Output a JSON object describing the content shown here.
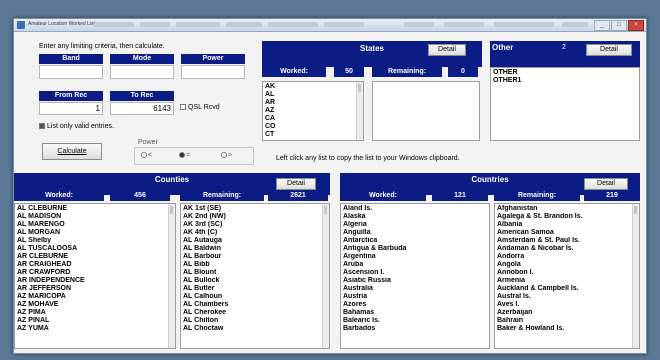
{
  "window": {
    "title": "Amateur Location Worked List"
  },
  "filter": {
    "instruction": "Enter any limiting criteria, then calculate.",
    "band_label": "Band",
    "band_value": "",
    "mode_label": "Mode",
    "mode_value": "",
    "power_label": "Power",
    "power_value": "",
    "from_rec_label": "From Rec",
    "from_rec_value": "1",
    "to_rec_label": "To Rec",
    "to_rec_value": "6143",
    "qsl_label": "QSL Rcvd",
    "valid_only_label": "List only valid entries.",
    "calculate_label": "Calculate",
    "power_group_label": "Power",
    "power_options": [
      "<",
      "=",
      ">"
    ],
    "power_selected": "="
  },
  "hint": "Left click any list to copy the list to your Windows clipboard.",
  "states": {
    "title": "States",
    "detail_label": "Detail",
    "worked_label": "Worked:",
    "worked_count": "50",
    "remaining_label": "Remaining:",
    "remaining_count": "0",
    "worked_items": [
      "AK",
      "AL",
      "AR",
      "AZ",
      "CA",
      "CO",
      "CT"
    ],
    "remaining_items": []
  },
  "other": {
    "title": "Other",
    "count": "2",
    "detail_label": "Detail",
    "items": [
      "OTHER",
      "OTHER1"
    ]
  },
  "counties": {
    "title": "Counties",
    "detail_label": "Detail",
    "worked_label": "Worked:",
    "worked_count": "456",
    "remaining_label": "Remaining:",
    "remaining_count": "2621",
    "worked_items": [
      "AL  CLEBURNE",
      "AL  MADISON",
      "AL  MARENGO",
      "AL  MORGAN",
      "AL  Shelby",
      "AL  TUSCALOOSA",
      "AR  CLEBURNE",
      "AR  CRAIGHEAD",
      "AR  CRAWFORD",
      "AR  INDEPENDENCE",
      "AR  JEFFERSON",
      "AZ  MARICOPA",
      "AZ  MOHAVE",
      "AZ  PIMA",
      "AZ  PINAL",
      "AZ  YUMA"
    ],
    "remaining_items": [
      "AK  1st (SE)",
      "AK  2nd (NW)",
      "AK  3rd (SC)",
      "AK  4th (C)",
      "AL  Autauga",
      "AL  Baldwin",
      "AL  Barbour",
      "AL  Bibb",
      "AL  Blount",
      "AL  Bullock",
      "AL  Butler",
      "AL  Calhoun",
      "AL  Chambers",
      "AL  Cherokee",
      "AL  Chilton",
      "AL  Choctaw"
    ]
  },
  "countries": {
    "title": "Countries",
    "detail_label": "Detail",
    "worked_label": "Worked:",
    "worked_count": "121",
    "remaining_label": "Remaining:",
    "remaining_count": "219",
    "worked_items": [
      "Aland Is.",
      "Alaska",
      "Algeria",
      "Anguilla",
      "Antarctica",
      "Antigua & Barbuda",
      "Argentina",
      "Aruba",
      "Ascension I.",
      "Asiatic Russia",
      "Australia",
      "Austria",
      "Azores",
      "Bahamas",
      "Balearic Is.",
      "Barbados"
    ],
    "remaining_items": [
      "Afghanistan",
      "Agalega & St. Brandon Is.",
      "Albania",
      "American Samoa",
      "Amsterdam & St. Paul Is.",
      "Andaman & Nicobar Is.",
      "Andorra",
      "Angola",
      "Annobon I.",
      "Armenia",
      "Auckland & Campbell Is.",
      "Austral Is.",
      "Aves I.",
      "Azerbaijan",
      "Bahrain",
      "Baker & Howland Is."
    ]
  }
}
